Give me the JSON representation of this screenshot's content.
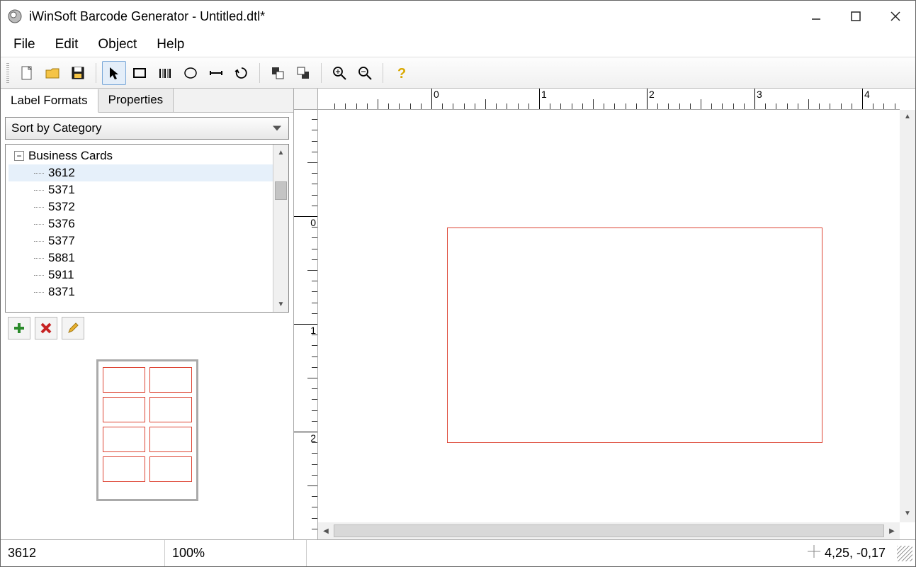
{
  "window": {
    "title": "iWinSoft Barcode Generator - Untitled.dtl*"
  },
  "menu": {
    "file": "File",
    "edit": "Edit",
    "object": "Object",
    "help": "Help"
  },
  "tabs": {
    "label_formats": "Label Formats",
    "properties": "Properties"
  },
  "sort_select": {
    "value": "Sort by Category"
  },
  "tree": {
    "root": "Business Cards",
    "items": [
      "3612",
      "5371",
      "5372",
      "5376",
      "5377",
      "5881",
      "5911",
      "8371"
    ],
    "selected": "3612"
  },
  "ruler": {
    "h_majors": [
      0,
      1,
      2,
      3,
      4
    ],
    "v_majors": [
      0,
      1,
      2
    ]
  },
  "status": {
    "item": "3612",
    "zoom": "100%",
    "coords": "4,25, -0,17"
  }
}
